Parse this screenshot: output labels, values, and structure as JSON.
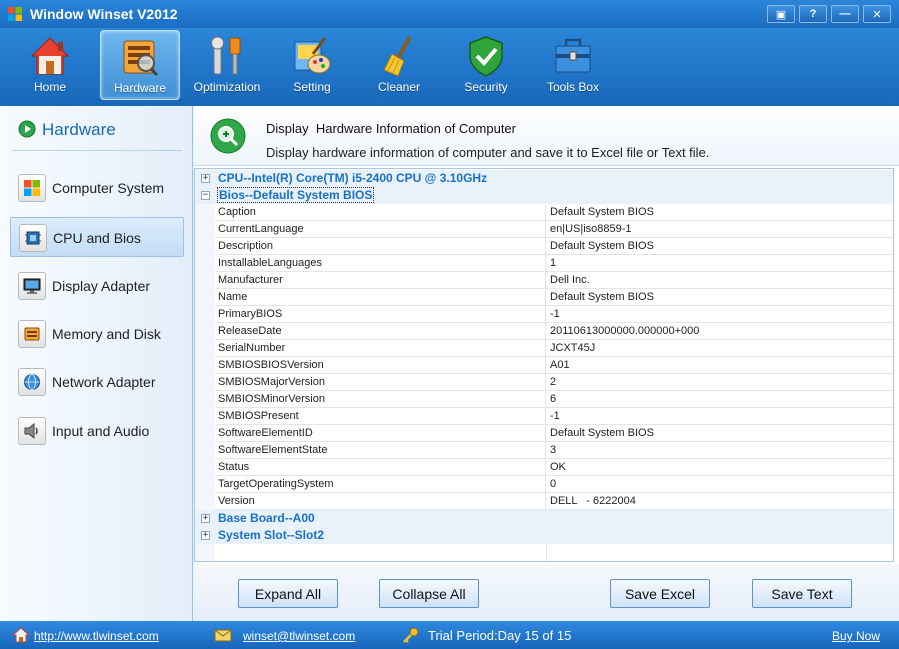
{
  "window": {
    "title": "Window Winset V2012",
    "buttons": [
      "▣",
      "?",
      "—",
      "✕"
    ]
  },
  "toolbar": {
    "items": [
      {
        "label": "Home",
        "icon": "house-icon"
      },
      {
        "label": "Hardware",
        "icon": "hardware-icon"
      },
      {
        "label": "Optimization",
        "icon": "wrench-icon"
      },
      {
        "label": "Setting",
        "icon": "paint-icon"
      },
      {
        "label": "Cleaner",
        "icon": "broom-icon"
      },
      {
        "label": "Security",
        "icon": "shield-check-icon"
      },
      {
        "label": "Tools Box",
        "icon": "toolbox-icon"
      }
    ],
    "active": "Hardware"
  },
  "sidebar": {
    "title": "Hardware",
    "items": [
      {
        "label": "Computer System",
        "icon": "windows-logo-icon"
      },
      {
        "label": "CPU and Bios",
        "icon": "chip-icon"
      },
      {
        "label": "Display Adapter",
        "icon": "monitor-icon"
      },
      {
        "label": "Memory and Disk",
        "icon": "memory-icon"
      },
      {
        "label": "Network Adapter",
        "icon": "globe-icon"
      },
      {
        "label": "Input and Audio",
        "icon": "speaker-icon"
      }
    ],
    "active": "CPU and Bios"
  },
  "header": {
    "title": "Display  Hardware Information of Computer",
    "subtitle": "Display hardware information of computer and save it to Excel file or Text file."
  },
  "grid": {
    "groups": [
      {
        "label": "CPU--Intel(R) Core(TM) i5-2400 CPU @ 3.10GHz",
        "expander": "+"
      },
      {
        "label": "Bios--Default System BIOS",
        "expander": "−"
      },
      {
        "label": "Base Board--A00",
        "expander": "+"
      },
      {
        "label": "System Slot--Slot2",
        "expander": "+"
      }
    ],
    "bios_rows": [
      {
        "name": "Caption",
        "value": "Default System BIOS"
      },
      {
        "name": "CurrentLanguage",
        "value": "en|US|iso8859-1"
      },
      {
        "name": "Description",
        "value": "Default System BIOS"
      },
      {
        "name": "InstallableLanguages",
        "value": "1"
      },
      {
        "name": "Manufacturer",
        "value": "Dell Inc."
      },
      {
        "name": "Name",
        "value": "Default System BIOS"
      },
      {
        "name": "PrimaryBIOS",
        "value": "-1"
      },
      {
        "name": "ReleaseDate",
        "value": "20110613000000.000000+000"
      },
      {
        "name": "SerialNumber",
        "value": "JCXT45J"
      },
      {
        "name": "SMBIOSBIOSVersion",
        "value": "A01"
      },
      {
        "name": "SMBIOSMajorVersion",
        "value": "2"
      },
      {
        "name": "SMBIOSMinorVersion",
        "value": "6"
      },
      {
        "name": "SMBIOSPresent",
        "value": "-1"
      },
      {
        "name": "SoftwareElementID",
        "value": "Default System BIOS"
      },
      {
        "name": "SoftwareElementState",
        "value": "3"
      },
      {
        "name": "Status",
        "value": "OK"
      },
      {
        "name": "TargetOperatingSystem",
        "value": "0"
      },
      {
        "name": "Version",
        "value": "DELL   - 6222004"
      }
    ]
  },
  "buttons": {
    "expand_all": "Expand All",
    "collapse_all": "Collapse All",
    "save_excel": "Save Excel",
    "save_text": "Save Text"
  },
  "status": {
    "website": "http://www.tlwinset.com",
    "email": "winset@tlwinset.com",
    "trial": "Trial Period:Day 15 of 15",
    "buy": "Buy Now"
  },
  "colors": {
    "accent": "#1b6dc2",
    "group_text": "#1770c7"
  }
}
